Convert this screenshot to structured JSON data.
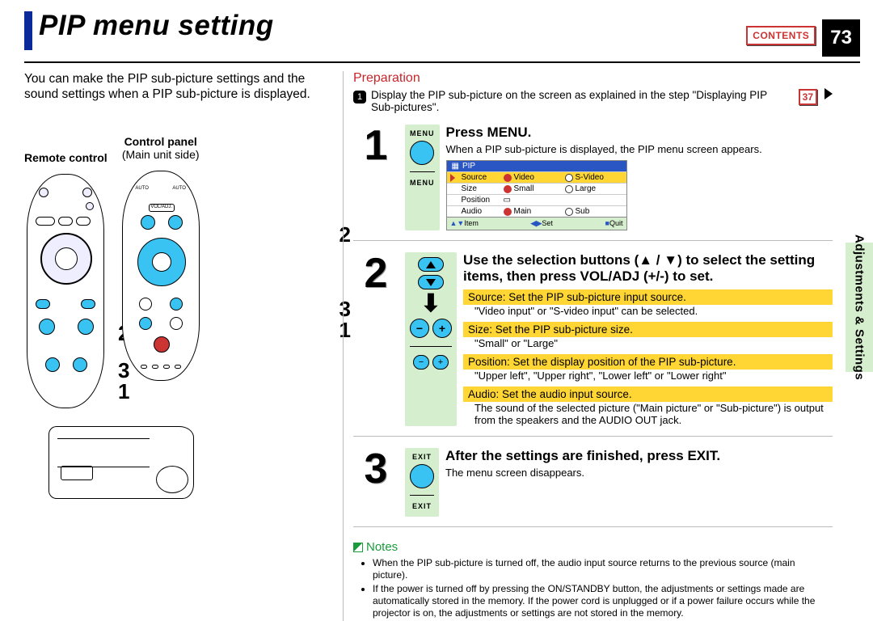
{
  "header": {
    "title": "PIP menu setting",
    "contentsLabel": "CONTENTS",
    "pageNumber": "73"
  },
  "sideTab": {
    "line1": "Adjustments &",
    "line2": "Settings"
  },
  "intro": "You can make the PIP sub-picture settings and the sound settings when a PIP sub-picture is displayed.",
  "deviceLabels": {
    "remote": "Remote control",
    "controlPanel": "Control panel",
    "controlPanelSub": "(Main unit side)"
  },
  "markers": {
    "remote": [
      "2",
      "3",
      "1"
    ],
    "cp": [
      "2",
      "3",
      "1"
    ]
  },
  "preparation": {
    "title": "Preparation",
    "bullet": "1",
    "text": "Display the PIP sub-picture on the screen as explained in the step \"Displaying PIP Sub-pictures\".",
    "ref": "37"
  },
  "steps": [
    {
      "num": "1",
      "btnTopLabel": "MENU",
      "btnBottomLabel": "MENU",
      "heading": "Press MENU.",
      "sub": "When a PIP sub-picture is displayed, the PIP menu screen appears."
    },
    {
      "num": "2",
      "heading": "Use the selection buttons (▲ / ▼) to select the setting items, then press VOL/ADJ (+/-) to set.",
      "items": [
        {
          "bar": "Source: Set the PIP sub-picture input source.",
          "note": "\"Video input\" or \"S-video input\" can be selected."
        },
        {
          "bar": "Size: Set the PIP sub-picture size.",
          "note": "\"Small\" or \"Large\""
        },
        {
          "bar": "Position: Set the display position of the PIP sub-picture.",
          "note": "\"Upper left\", \"Upper right\", \"Lower left\" or \"Lower right\""
        },
        {
          "bar": "Audio: Set the audio input source.",
          "note": "The sound of the selected picture (\"Main picture\" or \"Sub-picture\") is output from the speakers and the AUDIO OUT jack."
        }
      ]
    },
    {
      "num": "3",
      "btnTopLabel": "EXIT",
      "btnBottomLabel": "EXIT",
      "heading": "After the settings are finished, press EXIT.",
      "sub": "The menu screen disappears."
    }
  ],
  "pipMenu": {
    "title": "PIP",
    "rows": [
      {
        "label": "Source",
        "opt1": "Video",
        "opt2": "S-Video",
        "sel": 1,
        "hl": true
      },
      {
        "label": "Size",
        "opt1": "Small",
        "opt2": "Large",
        "sel": 1
      },
      {
        "label": "Position",
        "opt1": "",
        "opt2": "",
        "sel": 0
      },
      {
        "label": "Audio",
        "opt1": "Main",
        "opt2": "Sub",
        "sel": 1
      }
    ],
    "footer": {
      "left": "Item",
      "mid": "Set",
      "right": "Quit"
    }
  },
  "notes": {
    "title": "Notes",
    "items": [
      "When the PIP sub-picture is turned off, the audio input source returns to the previous source (main picture).",
      "If the power is turned off by pressing the ON/STANDBY button, the adjustments or settings made are automatically stored in the memory. If the power cord is unplugged or if a power failure occurs while the projector is on, the adjustments or settings are not stored in the memory."
    ]
  },
  "minusPlus": {
    "minus": "−",
    "plus": "+"
  }
}
